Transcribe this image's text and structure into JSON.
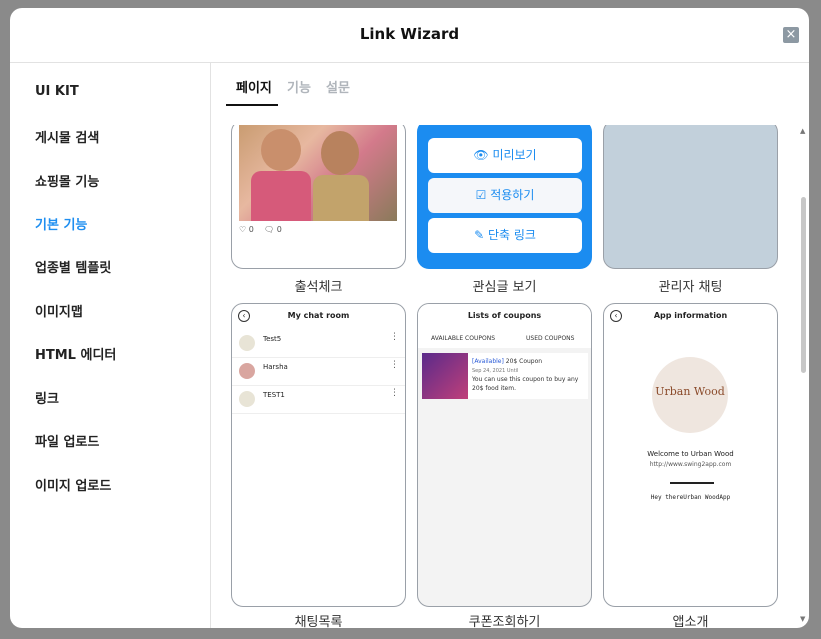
{
  "header": {
    "title": "Link Wizard",
    "close": "×"
  },
  "sidebar": {
    "items": [
      {
        "label": "UI KIT"
      },
      {
        "label": "게시물 검색"
      },
      {
        "label": "쇼핑몰 기능"
      },
      {
        "label": "기본 기능"
      },
      {
        "label": "업종별 템플릿"
      },
      {
        "label": "이미지맵"
      },
      {
        "label": "HTML 에디터"
      },
      {
        "label": "링크"
      },
      {
        "label": "파일 업로드"
      },
      {
        "label": "이미지 업로드"
      }
    ],
    "active": "기본 기능",
    "active_color": "#1e8ef0"
  },
  "tabs": [
    {
      "label": "페이지"
    },
    {
      "label": "기능"
    },
    {
      "label": "설문"
    }
  ],
  "cards": {
    "attendance": {
      "label": "출석체크",
      "likes": "0",
      "comments": "0"
    },
    "interest": {
      "label": "관심글 보기",
      "preview_button": "미리보기",
      "apply_button": "적용하기",
      "shortlink_button": "단축 링크",
      "accent": "#1b8cf0"
    },
    "admin_chat": {
      "label": "관리자 채팅"
    },
    "chat_list": {
      "label": "채팅목록",
      "header": "My chat room",
      "rows": [
        {
          "name": "Test5"
        },
        {
          "name": "Harsha"
        },
        {
          "name": "TEST1"
        }
      ]
    },
    "coupons": {
      "label": "쿠폰조회하기",
      "header": "Lists of coupons",
      "tab_available": "AVAILABLE COUPONS",
      "tab_used": "USED COUPONS",
      "coupon_status": "[Available]",
      "coupon_title": "20$ Coupon",
      "coupon_date": "Sep 24, 2021 Until",
      "coupon_desc1": "You can use this coupon to buy any",
      "coupon_desc2": "20$ food item."
    },
    "app_intro": {
      "label": "앱소개",
      "header": "App information",
      "logo_text": "Urban Wood",
      "welcome": "Welcome to Urban Wood",
      "url": "http://www.swing2app.com",
      "greeting": "Hey thereUrban WoodApp"
    }
  }
}
